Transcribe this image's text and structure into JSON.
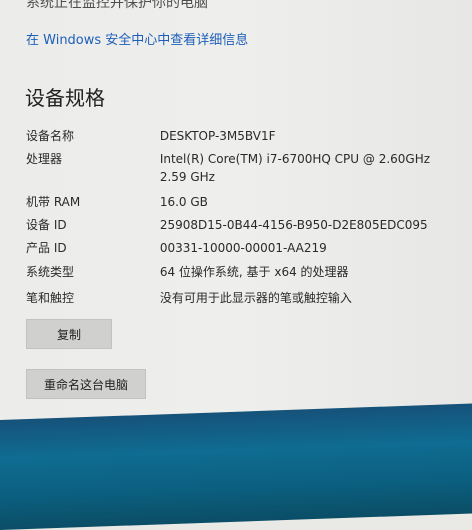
{
  "top_partial_text": "系统正在监控并保护你的电脑",
  "security_link": "在 Windows 安全中心中查看详细信息",
  "section_title": "设备规格",
  "specs": [
    {
      "label": "设备名称",
      "value": "DESKTOP-3M5BV1F"
    },
    {
      "label": "处理器",
      "value": "Intel(R) Core(TM) i7-6700HQ CPU @ 2.60GHz",
      "value2": "2.59 GHz"
    },
    {
      "label": "机带 RAM",
      "value": "16.0 GB"
    },
    {
      "label": "设备 ID",
      "value": "25908D15-0B44-4156-B950-D2E805EDC095"
    },
    {
      "label": "产品 ID",
      "value": "00331-10000-00001-AA219"
    },
    {
      "label": "系统类型",
      "value": "64 位操作系统, 基于 x64 的处理器"
    },
    {
      "label": "笔和触控",
      "value": "没有可用于此显示器的笔或触控输入"
    }
  ],
  "buttons": {
    "copy": "复制",
    "rename": "重命名这台电脑"
  }
}
